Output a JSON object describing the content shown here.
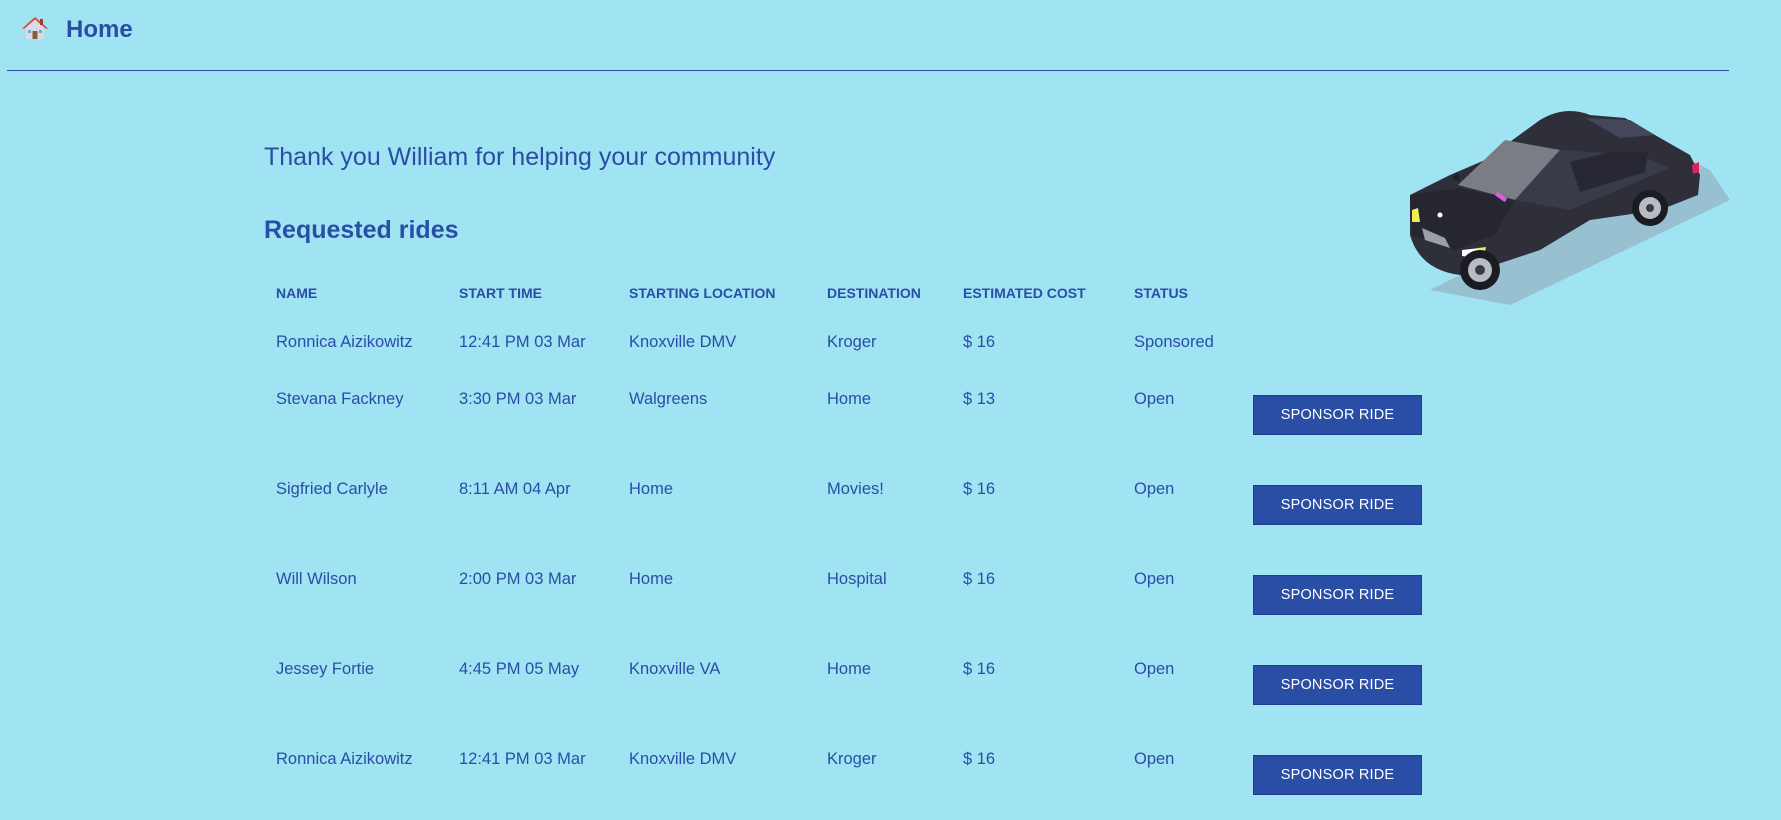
{
  "header": {
    "icon": "home-icon",
    "title": "Home"
  },
  "greeting": "Thank you William for helping your community",
  "section_title": "Requested rides",
  "table": {
    "columns": [
      "NAME",
      "START TIME",
      "STARTING LOCATION",
      "DESTINATION",
      "ESTIMATED COST",
      "STATUS"
    ],
    "rows": [
      {
        "name": "Ronnica Aizikowitz",
        "start": "12:41 PM 03 Mar",
        "location": "Knoxville DMV",
        "destination": "Kroger",
        "cost": "$ 16",
        "status": "Sponsored",
        "action": ""
      },
      {
        "name": "Stevana Fackney",
        "start": "3:30 PM 03 Mar",
        "location": "Walgreens",
        "destination": "Home",
        "cost": "$ 13",
        "status": "Open",
        "action": "SPONSOR RIDE"
      },
      {
        "name": "Sigfried Carlyle",
        "start": "8:11 AM 04 Apr",
        "location": "Home",
        "destination": "Movies!",
        "cost": "$ 16",
        "status": "Open",
        "action": "SPONSOR RIDE"
      },
      {
        "name": "Will Wilson",
        "start": "2:00 PM 03 Mar",
        "location": "Home",
        "destination": "Hospital",
        "cost": "$ 16",
        "status": "Open",
        "action": "SPONSOR RIDE"
      },
      {
        "name": "Jessey Fortie",
        "start": "4:45 PM 05 May",
        "location": "Knoxville VA",
        "destination": "Home",
        "cost": "$ 16",
        "status": "Open",
        "action": "SPONSOR RIDE"
      },
      {
        "name": "Ronnica Aizikowitz",
        "start": "12:41 PM 03 Mar",
        "location": "Knoxville DMV",
        "destination": "Kroger",
        "cost": "$ 16",
        "status": "Open",
        "action": "SPONSOR RIDE"
      }
    ]
  },
  "decoration": {
    "icon": "car-illustration"
  },
  "colors": {
    "background": "#a0e3f2",
    "primary": "#2a4ea6",
    "button_text": "#ffffff"
  }
}
